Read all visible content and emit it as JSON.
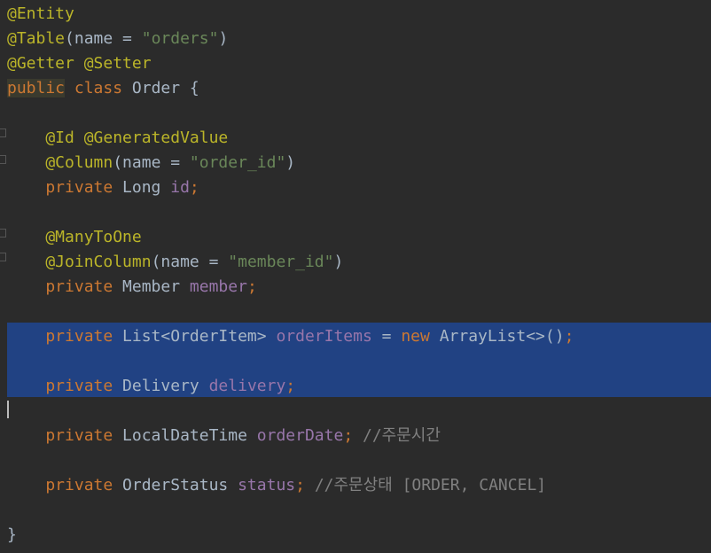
{
  "colors": {
    "background": "#2b2b2b",
    "selection": "#214283",
    "annotation": "#bbb529",
    "keyword": "#cc7832",
    "string": "#6a8759",
    "field": "#9876aa",
    "plain": "#a9b7c6",
    "comment": "#808080",
    "public_highlight": "#3a3a2e"
  },
  "lines": [
    {
      "tokens": [
        {
          "t": "@Entity",
          "k": "annotation"
        }
      ]
    },
    {
      "tokens": [
        {
          "t": "@Table",
          "k": "annotation"
        },
        {
          "t": "(name = ",
          "k": "plain"
        },
        {
          "t": "\"orders\"",
          "k": "string"
        },
        {
          "t": ")",
          "k": "plain"
        }
      ]
    },
    {
      "tokens": [
        {
          "t": "@Getter @Setter",
          "k": "annotation"
        }
      ]
    },
    {
      "tokens": [
        {
          "t": "public",
          "k": "keyword_hl"
        },
        {
          "t": " class ",
          "k": "keyword"
        },
        {
          "t": "Order {",
          "k": "plain"
        }
      ]
    },
    {
      "tokens": []
    },
    {
      "tokens": [
        {
          "t": "    @Id @GeneratedValue",
          "k": "annotation"
        }
      ]
    },
    {
      "tokens": [
        {
          "t": "    @Column",
          "k": "annotation"
        },
        {
          "t": "(name = ",
          "k": "plain"
        },
        {
          "t": "\"order_id\"",
          "k": "string"
        },
        {
          "t": ")",
          "k": "plain"
        }
      ]
    },
    {
      "tokens": [
        {
          "t": "    private ",
          "k": "keyword"
        },
        {
          "t": "Long ",
          "k": "plain"
        },
        {
          "t": "id",
          "k": "field"
        },
        {
          "t": ";",
          "k": "keyword"
        }
      ]
    },
    {
      "tokens": []
    },
    {
      "tokens": [
        {
          "t": "    @ManyToOne",
          "k": "annotation"
        }
      ]
    },
    {
      "tokens": [
        {
          "t": "    @JoinColumn",
          "k": "annotation"
        },
        {
          "t": "(name = ",
          "k": "plain"
        },
        {
          "t": "\"member_id\"",
          "k": "string"
        },
        {
          "t": ")",
          "k": "plain"
        }
      ]
    },
    {
      "tokens": [
        {
          "t": "    private ",
          "k": "keyword"
        },
        {
          "t": "Member ",
          "k": "plain"
        },
        {
          "t": "member",
          "k": "field"
        },
        {
          "t": ";",
          "k": "keyword"
        }
      ]
    },
    {
      "tokens": []
    },
    {
      "tokens": [
        {
          "t": "    private ",
          "k": "keyword"
        },
        {
          "t": "List<OrderItem> ",
          "k": "plain"
        },
        {
          "t": "orderItems",
          "k": "field"
        },
        {
          "t": " = ",
          "k": "plain"
        },
        {
          "t": "new ",
          "k": "keyword"
        },
        {
          "t": "ArrayList<>()",
          "k": "plain"
        },
        {
          "t": ";",
          "k": "keyword"
        }
      ]
    },
    {
      "tokens": []
    },
    {
      "tokens": [
        {
          "t": "    private ",
          "k": "keyword"
        },
        {
          "t": "Delivery ",
          "k": "plain"
        },
        {
          "t": "delivery",
          "k": "field"
        },
        {
          "t": ";",
          "k": "keyword"
        }
      ]
    },
    {
      "tokens": []
    },
    {
      "tokens": [
        {
          "t": "    private ",
          "k": "keyword"
        },
        {
          "t": "LocalDateTime ",
          "k": "plain"
        },
        {
          "t": "orderDate",
          "k": "field"
        },
        {
          "t": "; ",
          "k": "keyword"
        },
        {
          "t": "//주문시간",
          "k": "comment"
        }
      ]
    },
    {
      "tokens": []
    },
    {
      "tokens": [
        {
          "t": "    private ",
          "k": "keyword"
        },
        {
          "t": "OrderStatus ",
          "k": "plain"
        },
        {
          "t": "status",
          "k": "field"
        },
        {
          "t": "; ",
          "k": "keyword"
        },
        {
          "t": "//주문상태 [ORDER, CANCEL]",
          "k": "comment"
        }
      ]
    },
    {
      "tokens": []
    },
    {
      "tokens": [
        {
          "t": "}",
          "k": "plain"
        }
      ]
    }
  ]
}
